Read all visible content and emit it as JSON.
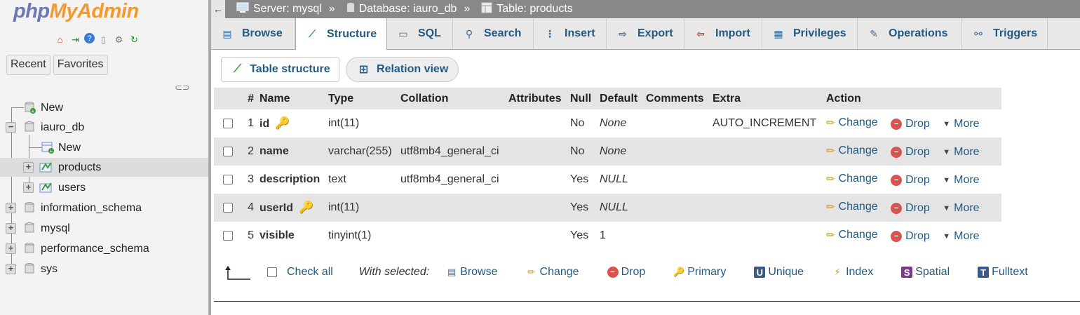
{
  "nav": {
    "logo_php": "php",
    "logo_admin": "MyAdmin",
    "tabs": [
      "Recent",
      "Favorites"
    ],
    "tree": [
      {
        "label": "New",
        "level": 0
      },
      {
        "label": "iauro_db",
        "level": 0,
        "expanded": true
      },
      {
        "label": "New",
        "level": 1
      },
      {
        "label": "products",
        "level": 1,
        "active": true
      },
      {
        "label": "users",
        "level": 1
      },
      {
        "label": "information_schema",
        "level": 0
      },
      {
        "label": "mysql",
        "level": 0
      },
      {
        "label": "performance_schema",
        "level": 0
      },
      {
        "label": "sys",
        "level": 0
      }
    ]
  },
  "breadcrumb": {
    "server": "Server: mysql",
    "database": "Database: iauro_db",
    "table": "Table: products",
    "sep": "»"
  },
  "tabs": [
    {
      "label": "Browse",
      "icon": "browse-icon"
    },
    {
      "label": "Structure",
      "icon": "structure-icon",
      "active": true
    },
    {
      "label": "SQL",
      "icon": "sql-icon"
    },
    {
      "label": "Search",
      "icon": "search-icon"
    },
    {
      "label": "Insert",
      "icon": "insert-icon"
    },
    {
      "label": "Export",
      "icon": "export-icon"
    },
    {
      "label": "Import",
      "icon": "import-icon"
    },
    {
      "label": "Privileges",
      "icon": "privileges-icon"
    },
    {
      "label": "Operations",
      "icon": "operations-icon"
    },
    {
      "label": "Triggers",
      "icon": "triggers-icon"
    }
  ],
  "subtabs": {
    "table_structure": "Table structure",
    "relation_view": "Relation view"
  },
  "table": {
    "headers": [
      "#",
      "Name",
      "Type",
      "Collation",
      "Attributes",
      "Null",
      "Default",
      "Comments",
      "Extra",
      "Action"
    ],
    "rows": [
      {
        "num": "1",
        "name": "id",
        "key": "primary",
        "type": "int(11)",
        "collation": "",
        "attributes": "",
        "null": "No",
        "default": "None",
        "comments": "",
        "extra": "AUTO_INCREMENT"
      },
      {
        "num": "2",
        "name": "name",
        "key": "",
        "type": "varchar(255)",
        "collation": "utf8mb4_general_ci",
        "attributes": "",
        "null": "No",
        "default": "None",
        "comments": "",
        "extra": ""
      },
      {
        "num": "3",
        "name": "description",
        "key": "",
        "type": "text",
        "collation": "utf8mb4_general_ci",
        "attributes": "",
        "null": "Yes",
        "default": "NULL",
        "comments": "",
        "extra": ""
      },
      {
        "num": "4",
        "name": "userId",
        "key": "index",
        "type": "int(11)",
        "collation": "",
        "attributes": "",
        "null": "Yes",
        "default": "NULL",
        "comments": "",
        "extra": ""
      },
      {
        "num": "5",
        "name": "visible",
        "key": "",
        "type": "tinyint(1)",
        "collation": "",
        "attributes": "",
        "null": "Yes",
        "default": "1",
        "comments": "",
        "extra": ""
      }
    ],
    "actions": {
      "change": "Change",
      "drop": "Drop",
      "more": "More"
    }
  },
  "bottom": {
    "check_all": "Check all",
    "with_selected": "With selected:",
    "actions": [
      "Browse",
      "Change",
      "Drop",
      "Primary",
      "Unique",
      "Index",
      "Spatial",
      "Fulltext"
    ]
  }
}
